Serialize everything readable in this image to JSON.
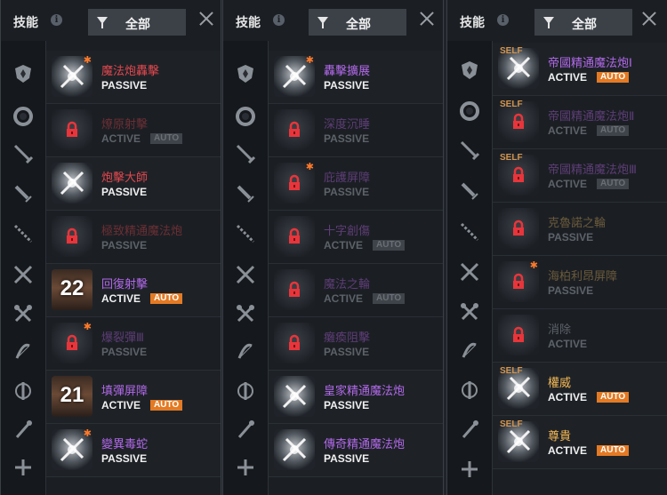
{
  "header": {
    "title": "技能",
    "info": "i",
    "filter_label": "全部"
  },
  "panels": [
    {
      "rows": [
        {
          "name": "魔法炮轟擊",
          "type": "PASSIVE",
          "auto": null,
          "state": "on",
          "color": "#e0484e",
          "badge": "star"
        },
        {
          "name": "燎原射擊",
          "type": "ACTIVE",
          "auto": "AUTO",
          "state": "locked",
          "color": "#6b2f34",
          "badge": null
        },
        {
          "name": "炮擊大師",
          "type": "PASSIVE",
          "auto": null,
          "state": "on",
          "color": "#e0484e",
          "badge": null
        },
        {
          "name": "極致精通魔法炮",
          "type": "PASSIVE",
          "auto": null,
          "state": "locked",
          "color": "#6b2f34",
          "badge": null
        },
        {
          "name": "回復射擊",
          "type": "ACTIVE",
          "auto": "AUTO",
          "state": "count",
          "count": "22",
          "color": "#b168e8",
          "badge": null
        },
        {
          "name": "爆裂彈Ⅲ",
          "type": "PASSIVE",
          "auto": null,
          "state": "locked",
          "color": "#5e3d76",
          "badge": "star"
        },
        {
          "name": "填彈屏障",
          "type": "ACTIVE",
          "auto": "AUTO",
          "state": "count",
          "count": "21",
          "color": "#b168e8",
          "badge": null
        },
        {
          "name": "變異毒蛇",
          "type": "PASSIVE",
          "auto": null,
          "state": "on",
          "color": "#b168e8",
          "badge": "star"
        }
      ]
    },
    {
      "rows": [
        {
          "name": "轟擊擴展",
          "type": "PASSIVE",
          "auto": null,
          "state": "on",
          "color": "#b168e8",
          "badge": "star"
        },
        {
          "name": "深度沉睡",
          "type": "PASSIVE",
          "auto": null,
          "state": "locked",
          "color": "#5e3d76",
          "badge": null
        },
        {
          "name": "庇護屏障",
          "type": "PASSIVE",
          "auto": null,
          "state": "locked",
          "color": "#5e3d76",
          "badge": "star"
        },
        {
          "name": "十字創傷",
          "type": "ACTIVE",
          "auto": "AUTO",
          "state": "locked",
          "color": "#5e3d76",
          "badge": null
        },
        {
          "name": "魔法之輪",
          "type": "ACTIVE",
          "auto": "AUTO",
          "state": "locked",
          "color": "#5e3d76",
          "badge": null
        },
        {
          "name": "癱瘓阻擊",
          "type": "PASSIVE",
          "auto": null,
          "state": "locked",
          "color": "#5e3d76",
          "badge": null
        },
        {
          "name": "皇家精通魔法炮",
          "type": "PASSIVE",
          "auto": null,
          "state": "on",
          "color": "#b168e8",
          "badge": null
        },
        {
          "name": "傳奇精通魔法炮",
          "type": "PASSIVE",
          "auto": null,
          "state": "on",
          "color": "#b168e8",
          "badge": null
        }
      ]
    },
    {
      "rows": [
        {
          "name": "帝國精通魔法炮Ⅰ",
          "type": "ACTIVE",
          "auto": "AUTO",
          "state": "on",
          "color": "#b168e8",
          "badge": "self"
        },
        {
          "name": "帝國精通魔法炮Ⅱ",
          "type": "ACTIVE",
          "auto": "AUTO",
          "state": "locked",
          "color": "#5e3d76",
          "badge": "self"
        },
        {
          "name": "帝國精通魔法炮Ⅲ",
          "type": "ACTIVE",
          "auto": "AUTO",
          "state": "locked",
          "color": "#5e3d76",
          "badge": "self"
        },
        {
          "name": "克魯諾之輪",
          "type": "PASSIVE",
          "auto": null,
          "state": "locked",
          "color": "#6b5a3b",
          "badge": null
        },
        {
          "name": "海柏利昂屏障",
          "type": "PASSIVE",
          "auto": null,
          "state": "locked",
          "color": "#6b5a3b",
          "badge": "star"
        },
        {
          "name": "消除",
          "type": "ACTIVE",
          "auto": null,
          "state": "locked",
          "color": "#5c6168",
          "badge": null
        },
        {
          "name": "權威",
          "type": "ACTIVE",
          "auto": "AUTO",
          "state": "on",
          "color": "#f5b955",
          "badge": "self"
        },
        {
          "name": "尊貴",
          "type": "ACTIVE",
          "auto": "AUTO",
          "state": "on",
          "color": "#f5b955",
          "badge": "self"
        }
      ]
    }
  ],
  "badge_text": {
    "self": "SELF",
    "star": "✱"
  },
  "sidebar_icons": [
    "shield-icon",
    "ring-icon",
    "sword-icon",
    "dagger-icon",
    "spear-icon",
    "crossed-swords-icon",
    "crossed-axes-icon",
    "bow-icon",
    "claw-icon",
    "wand-icon",
    "crossbow-icon"
  ]
}
